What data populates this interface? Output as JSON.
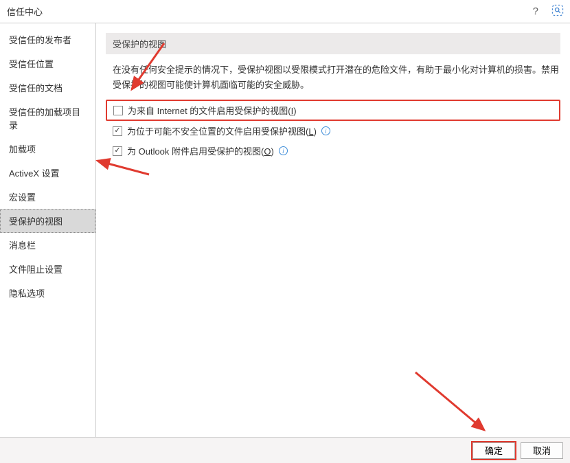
{
  "titlebar": {
    "title": "信任中心"
  },
  "sidebar": {
    "items": [
      {
        "label": "受信任的发布者"
      },
      {
        "label": "受信任位置"
      },
      {
        "label": "受信任的文档"
      },
      {
        "label": "受信任的加载项目录"
      },
      {
        "label": "加载项"
      },
      {
        "label": "ActiveX 设置"
      },
      {
        "label": "宏设置"
      },
      {
        "label": "受保护的视图"
      },
      {
        "label": "消息栏"
      },
      {
        "label": "文件阻止设置"
      },
      {
        "label": "隐私选项"
      }
    ]
  },
  "content": {
    "section_title": "受保护的视图",
    "description": "在没有任何安全提示的情况下，受保护视图以受限模式打开潜在的危险文件，有助于最小化对计算机的损害。禁用受保护的视图可能使计算机面临可能的安全威胁。",
    "checkboxes": [
      {
        "label_pre": "为来自 Internet 的文件启用受保护的视图(",
        "hotkey": "I",
        "label_post": ")",
        "checked": false,
        "info": false
      },
      {
        "label_pre": "为位于可能不安全位置的文件启用受保护视图(",
        "hotkey": "L",
        "label_post": ")",
        "checked": true,
        "info": true
      },
      {
        "label_pre": "为 Outlook 附件启用受保护的视图(",
        "hotkey": "O",
        "label_post": ")",
        "checked": true,
        "info": true
      }
    ]
  },
  "footer": {
    "ok": "确定",
    "cancel": "取消"
  },
  "colors": {
    "highlight": "#e03a2f"
  }
}
